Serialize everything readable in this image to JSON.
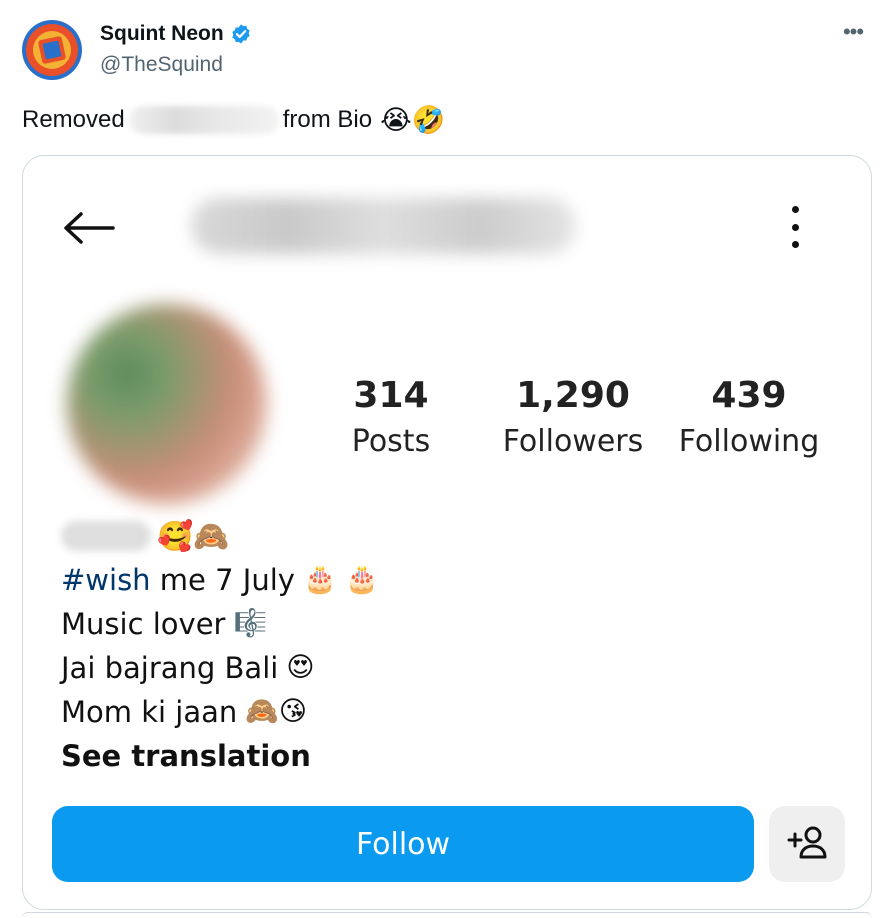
{
  "tweet": {
    "author_name": "Squint Neon",
    "author_handle": "@TheSquind",
    "more_icon": "more-horizontal-icon",
    "verified_icon": "verified-badge-icon",
    "text_before": "Removed",
    "text_after": "from Bio",
    "emojis": "😭🤣"
  },
  "profile_card": {
    "stats": {
      "posts_count": "314",
      "posts_label": "Posts",
      "followers_count": "1,290",
      "followers_label": "Followers",
      "following_count": "439",
      "following_label": "Following"
    },
    "bio": {
      "name_emojis": "🥰🙈",
      "hashtag": "#wish",
      "line1_rest": " me 7 July",
      "line1_emojis": "🎂 🎂",
      "line2": "Music lover",
      "line2_emoji": "🎼",
      "line3": "Jai bajrang Bali",
      "line3_emoji": "😍",
      "line4": "Mom ki jaan",
      "line4_emojis": "🙈😘",
      "see_translation": "See translation"
    },
    "follow_label": "Follow",
    "icons": {
      "back": "back-arrow-icon",
      "options": "vertical-dots-icon",
      "add_user": "add-user-icon"
    },
    "colors": {
      "follow_button": "#0a9bf0",
      "hashtag": "#00376b",
      "verified": "#1d9bf0"
    }
  }
}
